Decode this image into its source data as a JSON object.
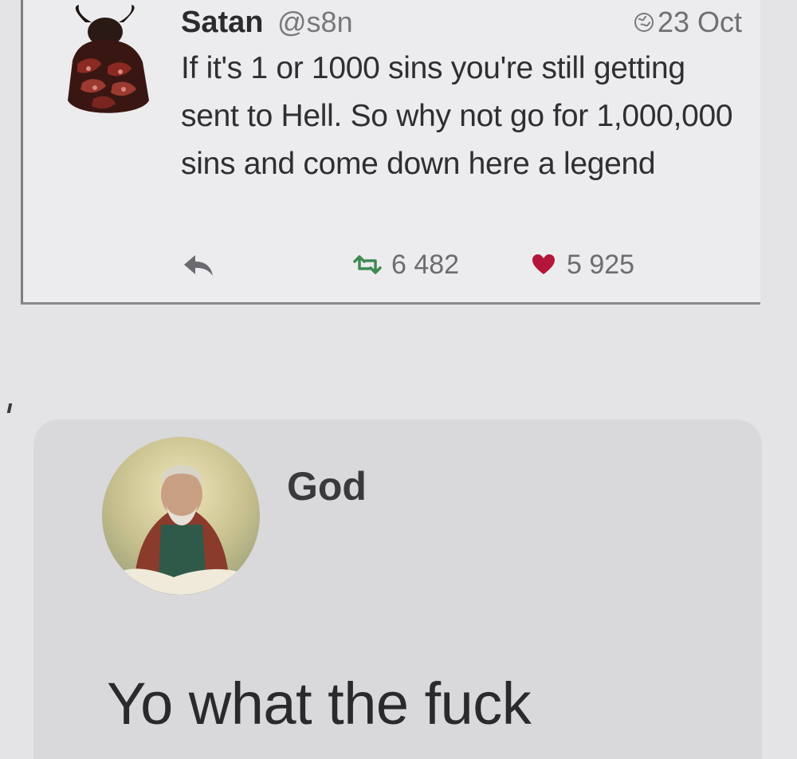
{
  "tweet": {
    "author_name": "Satan",
    "author_handle": "@s8n",
    "date": "23 Oct",
    "text": "If it's 1 or 1000 sins you're still getting sent to Hell. So why not go for 1,000,000 sins and come down here a legend",
    "retweet_count": "6 482",
    "like_count": "5 925",
    "icons": {
      "avatar": "demon-avatar",
      "date": "globe-icon",
      "reply": "reply-icon",
      "retweet": "retweet-icon",
      "like": "heart-icon"
    },
    "colors": {
      "retweet": "#3f8a52",
      "like": "#b5153a"
    }
  },
  "reply": {
    "author_name": "God",
    "text": "Yo what the fuck",
    "icons": {
      "avatar": "god-avatar"
    }
  }
}
